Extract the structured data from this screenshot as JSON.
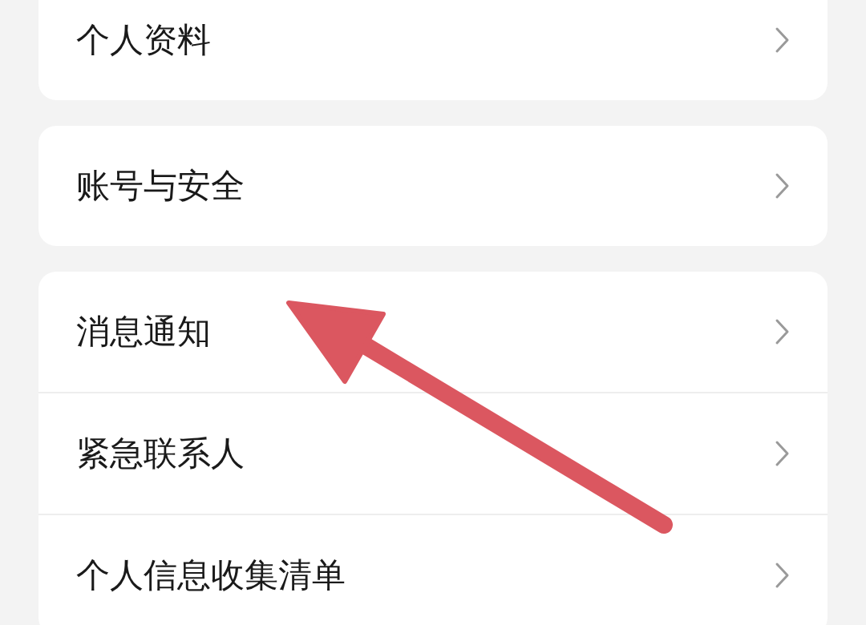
{
  "groups": [
    {
      "items": [
        {
          "label": "个人资料"
        }
      ]
    },
    {
      "items": [
        {
          "label": "账号与安全"
        }
      ]
    },
    {
      "items": [
        {
          "label": "消息通知"
        },
        {
          "label": "紧急联系人"
        },
        {
          "label": "个人信息收集清单"
        }
      ]
    }
  ],
  "annotation": {
    "kind": "arrow"
  }
}
